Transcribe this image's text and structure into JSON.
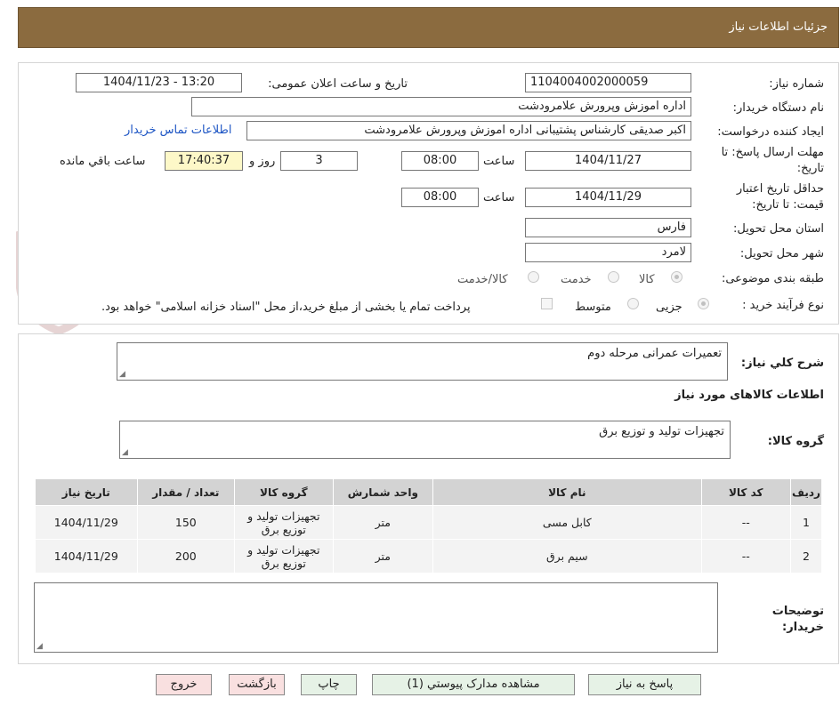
{
  "header": {
    "title": "جزئیات اطلاعات نیاز"
  },
  "form": {
    "need_number_label": "شماره نیاز:",
    "need_number": "1104004002000059",
    "announce_label": "تاریخ و ساعت اعلان عمومی:",
    "announce_value": "1404/11/23 - 13:20",
    "buyer_org_label": "نام دستگاه خریدار:",
    "buyer_org": "اداره اموزش وپرورش علامرودشت",
    "creator_label": "ایجاد کننده درخواست:",
    "creator": "اکبر صدیقی کارشناس پشتیبانی اداره اموزش وپرورش علامرودشت",
    "contact_link": "اطلاعات تماس خریدار",
    "deadline_label_line1": "مهلت ارسال پاسخ: تا",
    "deadline_label_line2": "تاریخ:",
    "deadline_date": "1404/11/27",
    "time_label": "ساعت",
    "deadline_time": "08:00",
    "days_value": "3",
    "days_label": "روز و",
    "remaining_time": "17:40:37",
    "remaining_label": "ساعت باقي مانده",
    "validity_label_line1": "حداقل تاریخ اعتبار",
    "validity_label_line2": "قیمت: تا تاریخ:",
    "validity_date": "1404/11/29",
    "validity_time_label": "ساعت",
    "validity_time": "08:00",
    "province_label": "استان محل تحویل:",
    "province": "فارس",
    "city_label": "شهر محل تحویل:",
    "city": "لامرد",
    "category_label": "طبقه بندی موضوعی:",
    "category_options": [
      "کالا",
      "خدمت",
      "کالا/خدمت"
    ],
    "category_selected": "کالا",
    "process_label": "نوع فرآیند خرید :",
    "process_options": [
      "جزیی",
      "متوسط"
    ],
    "process_selected": "جزیی",
    "payment_note": "پرداخت تمام یا بخشی از مبلغ خرید،از محل \"اسناد خزانه اسلامی\" خواهد بود."
  },
  "summary": {
    "label": "شرح کلي نیاز:",
    "value": "تعمیرات عمرانی مرحله دوم"
  },
  "goods": {
    "section_title": "اطلاعات کالاهای مورد نیاز",
    "group_label": "گروه کالا:",
    "group_value": "تجهیزات تولید و توزیع برق",
    "columns": [
      "ردیف",
      "کد کالا",
      "نام کالا",
      "واحد شمارش",
      "گروه کالا",
      "تعداد / مقدار",
      "تاریخ نیاز"
    ],
    "rows": [
      [
        "1",
        "--",
        "کابل مسی",
        "متر",
        "تجهیزات تولید و توزیع برق",
        "150",
        "1404/11/29"
      ],
      [
        "2",
        "--",
        "سیم برق",
        "متر",
        "تجهیزات تولید و توزیع برق",
        "200",
        "1404/11/29"
      ]
    ]
  },
  "notes": {
    "label_line1": "توضیحات",
    "label_line2": "خریدار:",
    "value": ""
  },
  "buttons": {
    "reply": "پاسخ به نیاز",
    "view_docs": "مشاهده مدارک پیوستي (1)",
    "print": "چاپ",
    "back": "بازگشت",
    "exit": "خروج"
  },
  "watermark": {
    "text": "AriaTender.neT"
  },
  "colors": {
    "header_bg": "#8b6b3f",
    "link": "#1d55c4",
    "table_header": "#d3d3d3",
    "remaining_bg": "#fdf8c8"
  },
  "icons": {
    "watermark_logo": "shield-logo-icon",
    "resize_handle": "resize-grip-icon"
  }
}
